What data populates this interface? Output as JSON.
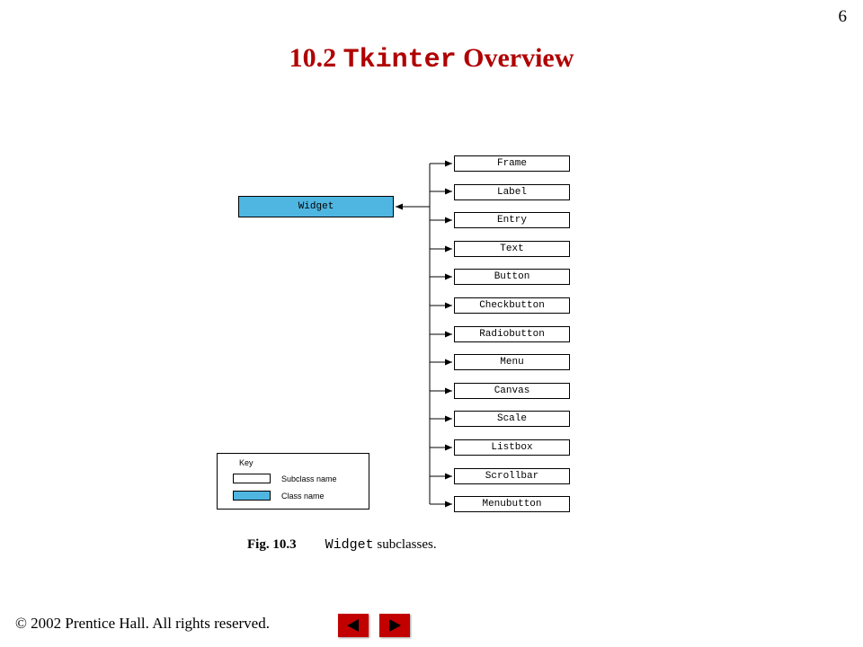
{
  "page_number": "6",
  "title": {
    "pre": "10.2 ",
    "mono": "Tkinter",
    "post": " Overview"
  },
  "widget_label": "Widget",
  "subclasses": [
    "Frame",
    "Label",
    "Entry",
    "Text",
    "Button",
    "Checkbutton",
    "Radiobutton",
    "Menu",
    "Canvas",
    "Scale",
    "Listbox",
    "Scrollbar",
    "Menubutton"
  ],
  "key": {
    "title": "Key",
    "subclass": "Subclass name",
    "classname": "Class name"
  },
  "caption": {
    "fignum": "Fig. 10.3",
    "mono": "Widget",
    "post": " subclasses."
  },
  "footer": {
    "copyright": "© ",
    "text": "2002 Prentice Hall. All rights reserved."
  }
}
